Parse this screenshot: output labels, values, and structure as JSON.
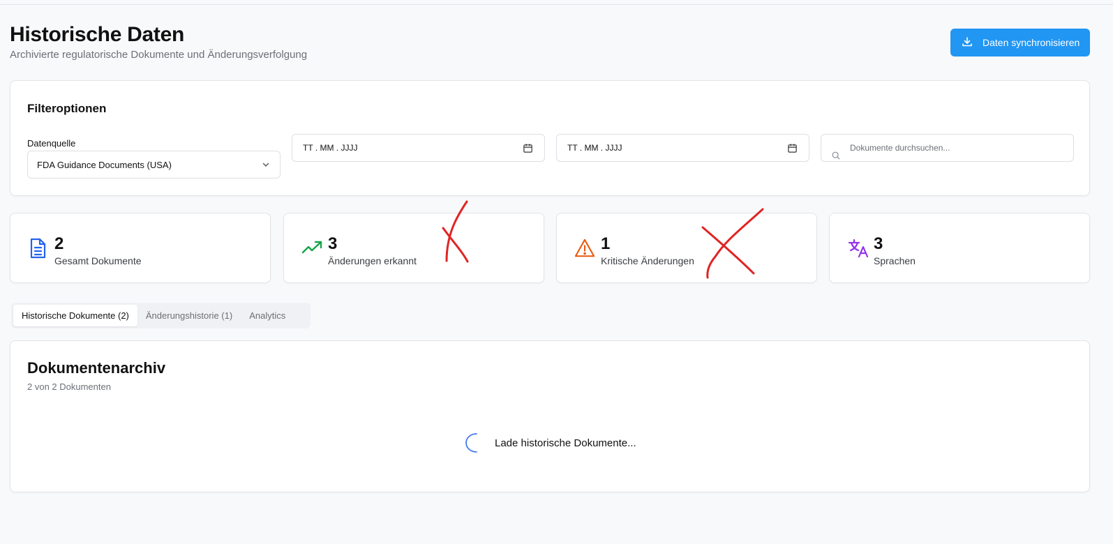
{
  "header": {
    "title": "Historische Daten",
    "subtitle": "Archivierte regulatorische Dokumente und Änderungsverfolgung",
    "sync_button": "Daten synchronisieren",
    "sync_icon": "download-icon"
  },
  "filters": {
    "title": "Filteroptionen",
    "source_label": "Datenquelle",
    "source_value": "FDA Guidance Documents (USA)",
    "date_from": "TT . MM . JJJJ",
    "date_to": "TT . MM . JJJJ",
    "search_placeholder": "Dokumente durchsuchen..."
  },
  "stats": [
    {
      "value": "2",
      "label": "Gesamt Dokumente",
      "icon": "document-icon",
      "color": "#2563eb"
    },
    {
      "value": "3",
      "label": "Änderungen erkannt",
      "icon": "trending-up-icon",
      "color": "#16a34a"
    },
    {
      "value": "1",
      "label": "Kritische Änderungen",
      "icon": "warning-icon",
      "color": "#ea580c"
    },
    {
      "value": "3",
      "label": "Sprachen",
      "icon": "translate-icon",
      "color": "#9333ea"
    }
  ],
  "tabs": [
    {
      "label": "Historische Dokumente (2)",
      "active": true
    },
    {
      "label": "Änderungshistorie (1)",
      "active": false
    },
    {
      "label": "Analytics",
      "active": false
    }
  ],
  "archive": {
    "title": "Dokumentenarchiv",
    "count": "2 von 2 Dokumenten",
    "loading": "Lade historische Dokumente..."
  },
  "colors": {
    "accent": "#2196f3",
    "annotation": "#e02424"
  }
}
